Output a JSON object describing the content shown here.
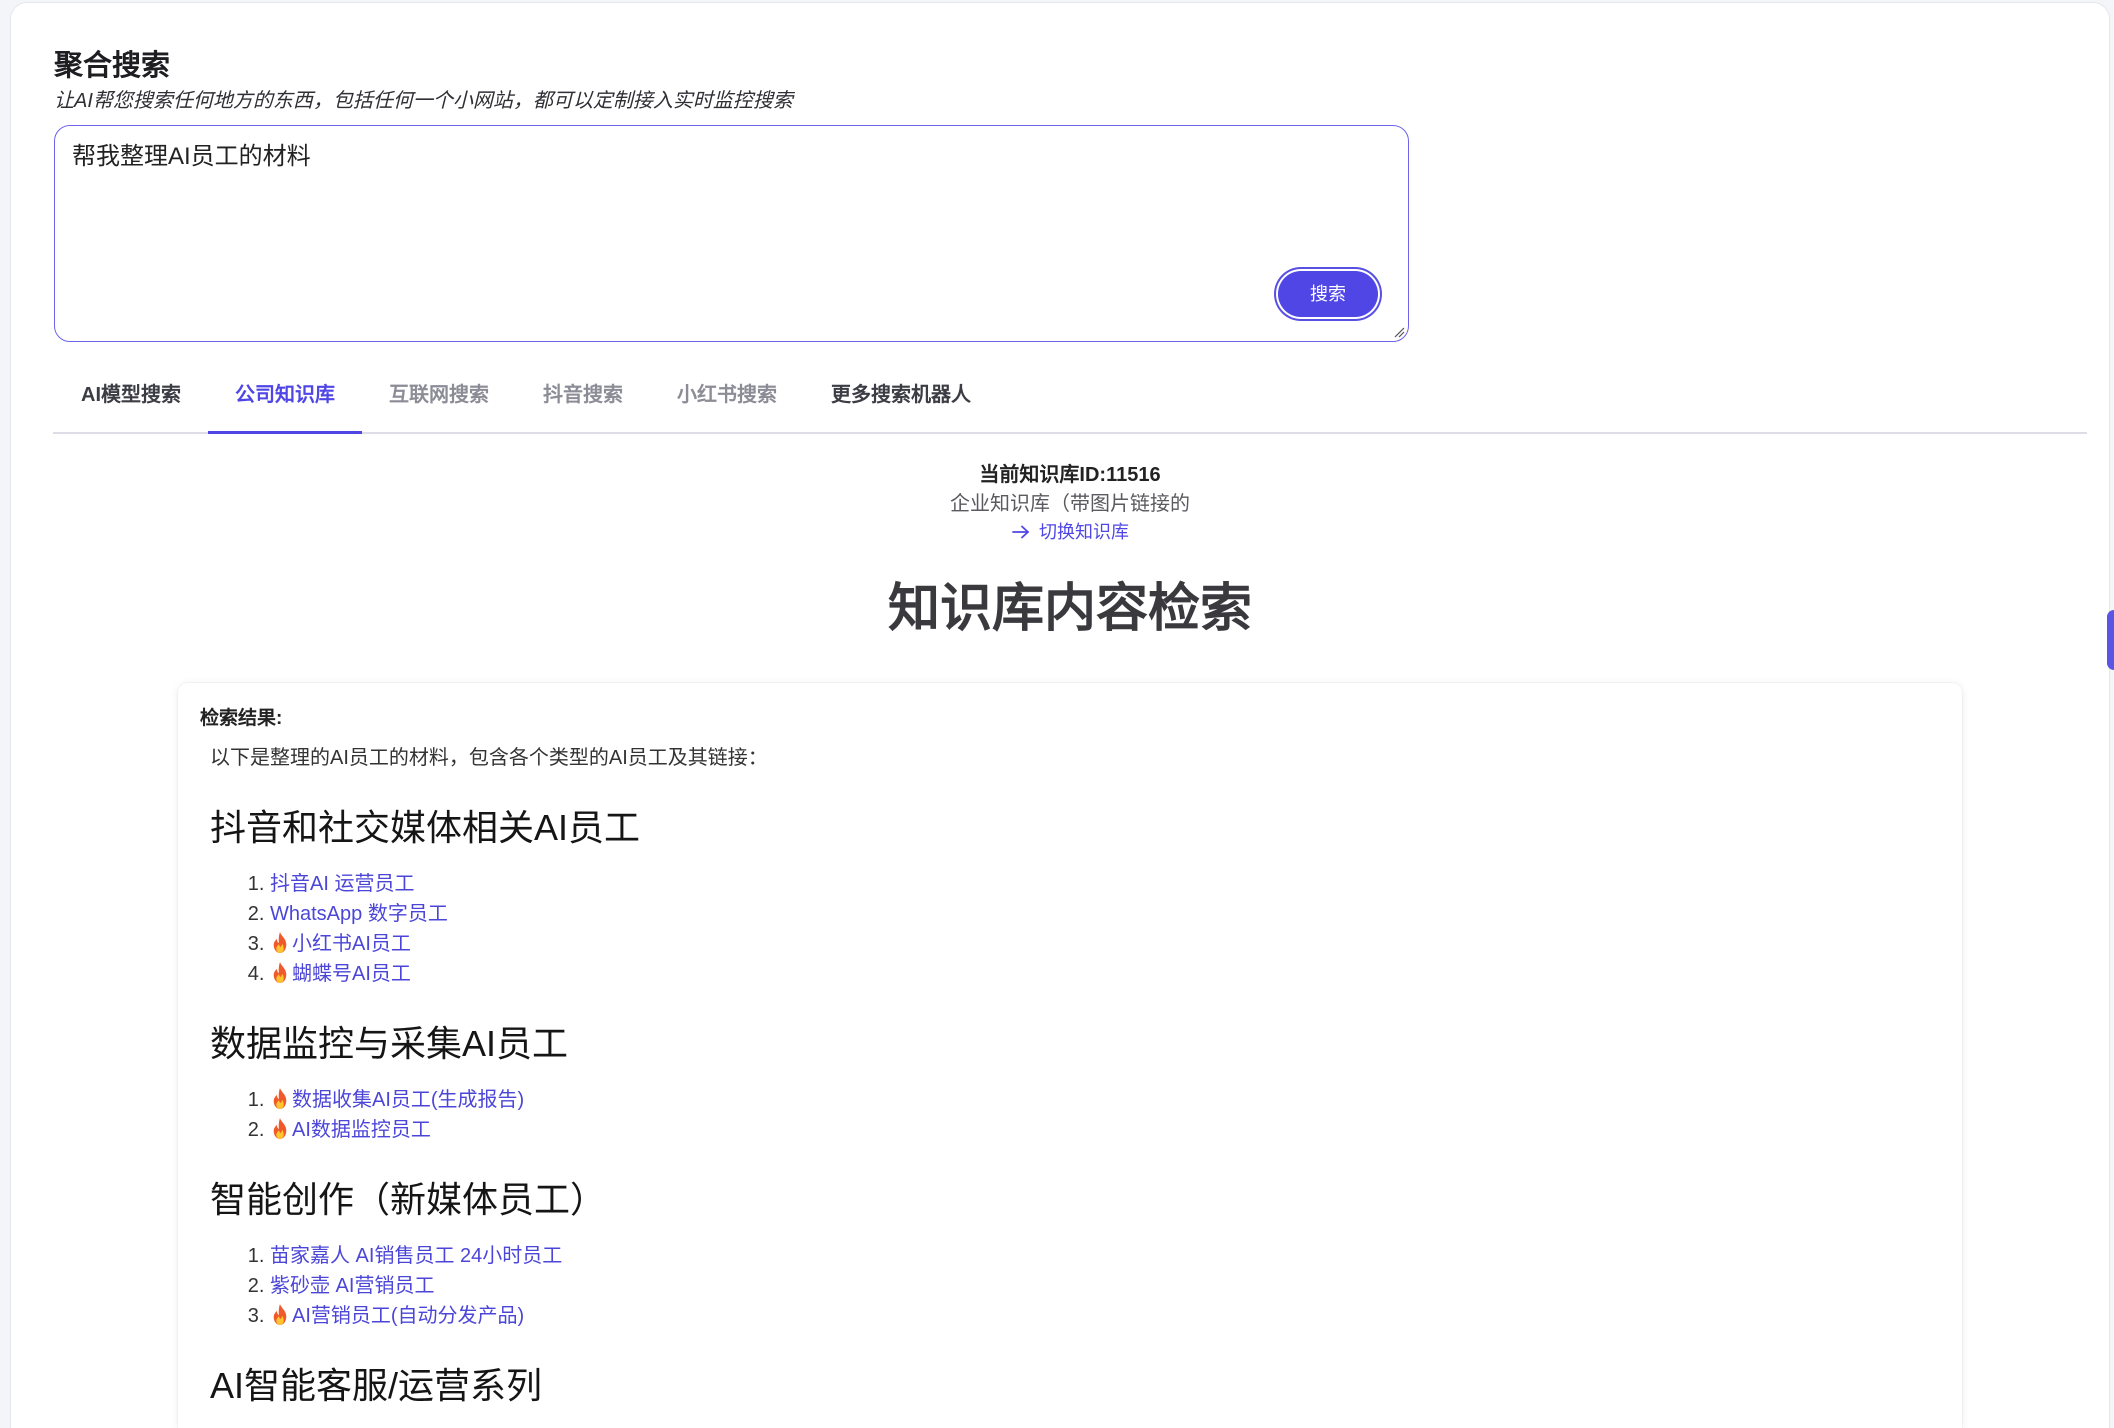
{
  "header": {
    "title": "聚合搜索",
    "subtitle": "让AI帮您搜索任何地方的东西，包括任何一个小网站，都可以定制接入实时监控搜索"
  },
  "search": {
    "query": "帮我整理AI员工的材料",
    "button_label": "搜索"
  },
  "tabs": [
    {
      "label": "AI模型搜索",
      "state": "normal"
    },
    {
      "label": "公司知识库",
      "state": "active"
    },
    {
      "label": "互联网搜索",
      "state": "muted"
    },
    {
      "label": "抖音搜索",
      "state": "muted"
    },
    {
      "label": "小红书搜索",
      "state": "muted"
    },
    {
      "label": "更多搜索机器人",
      "state": "normal"
    }
  ],
  "knowledge_base": {
    "current_id": "当前知识库ID:11516",
    "name": "企业知识库（带图片链接的",
    "switch_label": "切换知识库",
    "switch_icon": "arrow-right-icon"
  },
  "main_heading": "知识库内容检索",
  "results": {
    "label": "检索结果:",
    "intro": "以下是整理的AI员工的材料，包含各个类型的AI员工及其链接：",
    "hot_icon": "fire-icon",
    "sections": [
      {
        "heading": "抖音和社交媒体相关AI员工",
        "items": [
          {
            "label": "抖音AI 运营员工",
            "hot": false
          },
          {
            "label": "WhatsApp 数字员工",
            "hot": false
          },
          {
            "label": "小红书AI员工",
            "hot": true
          },
          {
            "label": "蝴蝶号AI员工",
            "hot": true
          }
        ]
      },
      {
        "heading": "数据监控与采集AI员工",
        "items": [
          {
            "label": "数据收集AI员工(生成报告)",
            "hot": true
          },
          {
            "label": "AI数据监控员工",
            "hot": true
          }
        ]
      },
      {
        "heading": "智能创作（新媒体员工）",
        "items": [
          {
            "label": "苗家嘉人 AI销售员工 24小时员工",
            "hot": false
          },
          {
            "label": "紫砂壶 AI营销员工",
            "hot": false
          },
          {
            "label": "AI营销员工(自动分发产品)",
            "hot": true
          }
        ]
      },
      {
        "heading": "AI智能客服/运营系列",
        "items": []
      }
    ]
  },
  "colors": {
    "accent": "#4f46e5",
    "link": "#4c46d8",
    "muted_tab": "#8c8c96",
    "fire": "#f0592a"
  }
}
